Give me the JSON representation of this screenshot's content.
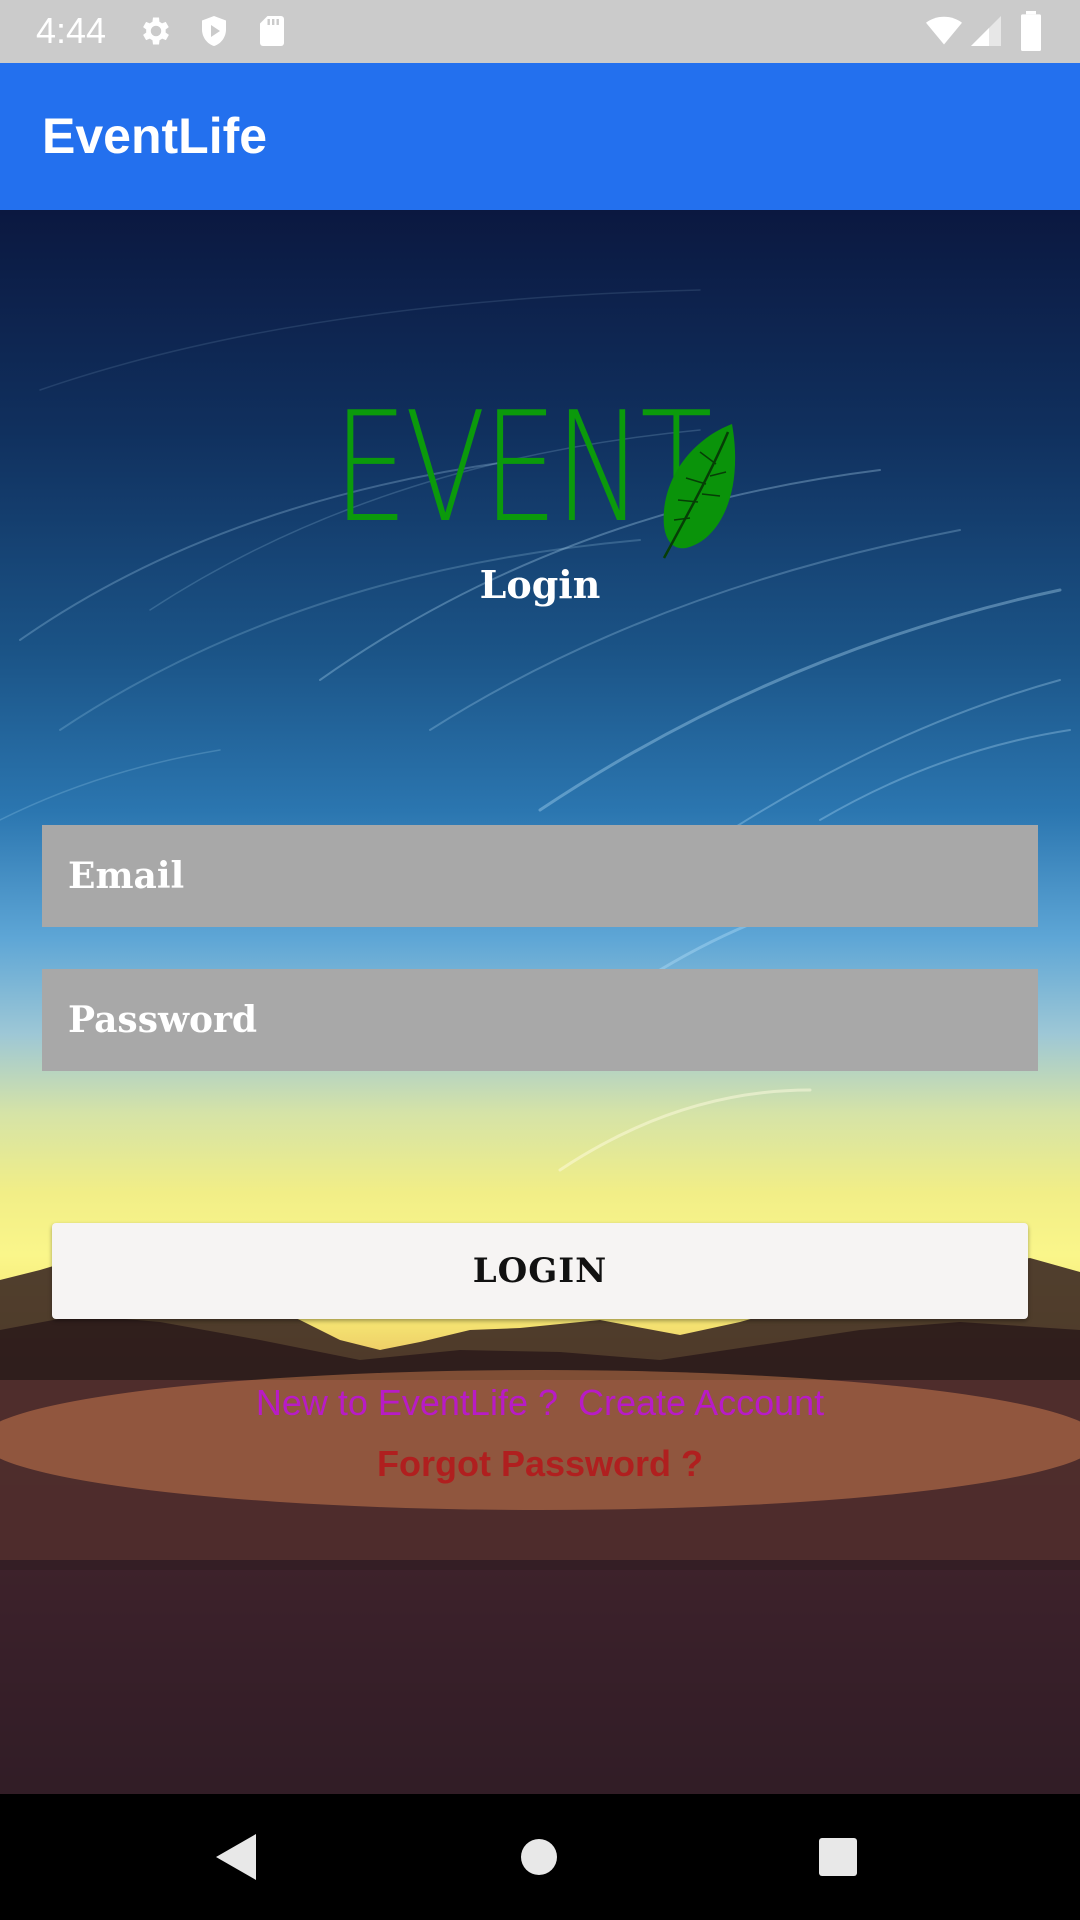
{
  "status_bar": {
    "time": "4:44",
    "icons": [
      "gear-icon",
      "shield-icon",
      "sd-card-icon",
      "wifi-icon",
      "signal-icon",
      "battery-icon"
    ]
  },
  "app_bar": {
    "title": "EventLife"
  },
  "logo": {
    "text": "EVENT",
    "subtitle": "Login"
  },
  "form": {
    "email_placeholder": "Email",
    "password_placeholder": "Password",
    "login_label": "LOGIN"
  },
  "links": {
    "new_prompt": "New to EventLife ?",
    "create_account": "Create Account",
    "forgot_password": "Forgot Password ?"
  },
  "nav_bar": {
    "icons": [
      "back-icon",
      "home-icon",
      "recents-icon"
    ]
  },
  "colors": {
    "app_bar": "#2370ee",
    "logo_green": "#0b9a0b",
    "input_bg": "#a8a8a8",
    "link_purple": "#b81bc6",
    "link_red": "#b01f1f"
  }
}
